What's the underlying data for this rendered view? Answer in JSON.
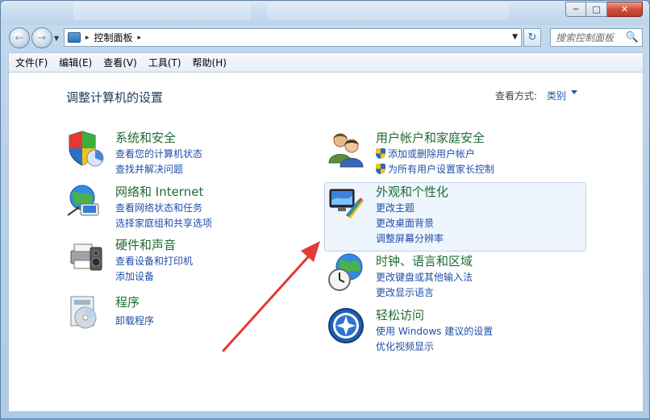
{
  "window": {
    "caption": {
      "minimize": "─",
      "maximize": "□",
      "close": "✕"
    }
  },
  "navigation": {
    "back_icon": "←",
    "forward_icon": "→",
    "recent_icon": "▼",
    "address": {
      "separator": "▸",
      "location": "控制面板",
      "trail_arrow": "▸",
      "dropdown_icon": "▼"
    },
    "refresh_icon": "↻",
    "search": {
      "placeholder": "搜索控制面板",
      "icon": "🔍"
    }
  },
  "menu": [
    "文件(F)",
    "编辑(E)",
    "查看(V)",
    "工具(T)",
    "帮助(H)"
  ],
  "header": {
    "title": "调整计算机的设置",
    "view_by_label": "查看方式:",
    "view_by_value": "类别"
  },
  "categories": [
    {
      "title": "系统和安全",
      "links": [
        "查看您的计算机状态",
        "查找并解决问题"
      ]
    },
    {
      "title": "网络和 Internet",
      "links": [
        "查看网络状态和任务",
        "选择家庭组和共享选项"
      ]
    },
    {
      "title": "硬件和声音",
      "links": [
        "查看设备和打印机",
        "添加设备"
      ]
    },
    {
      "title": "程序",
      "links": [
        "卸载程序"
      ]
    },
    {
      "title": "用户帐户和家庭安全",
      "links": [
        "添加或删除用户帐户",
        "为所有用户设置家长控制"
      ]
    },
    {
      "title": "外观和个性化",
      "links": [
        "更改主题",
        "更改桌面背景",
        "调整屏幕分辨率"
      ]
    },
    {
      "title": "时钟、语言和区域",
      "links": [
        "更改键盘或其他输入法",
        "更改显示语言"
      ]
    },
    {
      "title": "轻松访问",
      "links": [
        "使用 Windows 建议的设置",
        "优化视频显示"
      ]
    }
  ],
  "colors": {
    "category_title": "#1f6b32",
    "link": "#1f4fa8",
    "annotation_arrow": "#e53935"
  }
}
